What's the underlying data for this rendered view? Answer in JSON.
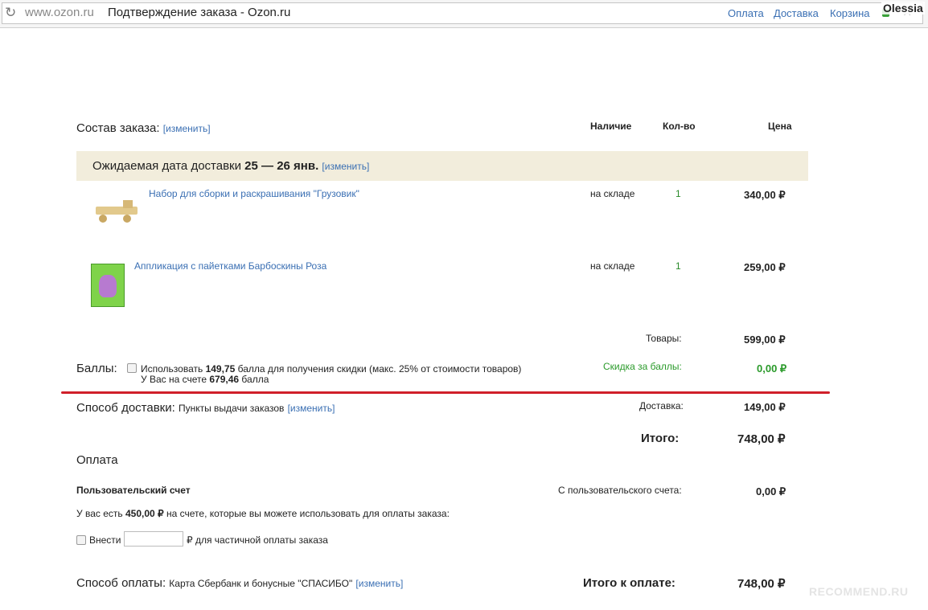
{
  "browser": {
    "url": "www.ozon.ru",
    "title": "Подтверждение заказа - Ozon.ru",
    "links": [
      "Оплата",
      "Доставка",
      "Корзина"
    ],
    "user": "Olessia"
  },
  "order": {
    "label": "Состав заказа:",
    "change": "[изменить]",
    "columns": {
      "availability": "Наличие",
      "qty": "Кол-во",
      "price": "Цена"
    },
    "delivery_date": {
      "prefix": "Ожидаемая дата доставки",
      "date": "25 — 26 янв.",
      "change": "[изменить]"
    },
    "items": [
      {
        "name": "Набор для сборки и раскрашивания \"Грузовик\"",
        "availability": "на складе",
        "qty": "1",
        "price": "340,00 ₽",
        "image_icon": "truck-toy-image"
      },
      {
        "name": "Аппликация с пайетками Барбоскины Роза",
        "availability": "на складе",
        "qty": "1",
        "price": "259,00 ₽",
        "image_icon": "craft-kit-image"
      }
    ],
    "goods_label": "Товары:",
    "goods_value": "599,00 ₽"
  },
  "points": {
    "label": "Баллы:",
    "use_text_pre": "Использовать",
    "use_amount": "149,75",
    "use_text_post": "балла для получения скидки (макс. 25% от стоимости товаров)",
    "balance_pre": "У Вас на счете",
    "balance_amount": "679,46",
    "balance_post": "балла",
    "discount_label": "Скидка за баллы:",
    "discount_value": "0,00 ₽"
  },
  "shipping": {
    "label": "Способ доставки:",
    "method": "Пункты выдачи заказов",
    "change": "[изменить]",
    "cost_label": "Доставка:",
    "cost_value": "149,00 ₽",
    "total_label": "Итого:",
    "total_value": "748,00 ₽"
  },
  "payment": {
    "label": "Оплата",
    "account_title": "Пользовательский счет",
    "account_charge_label": "С пользовательского счета:",
    "account_charge_value": "0,00 ₽",
    "balance_pre": "У вас есть",
    "balance_amount": "450,00 ₽",
    "balance_post": "на счете, которые вы можете использовать для оплаты заказа:",
    "deposit_label": "Внести",
    "deposit_suffix": "₽ для частичной оплаты заказа",
    "method_label": "Способ оплаты:",
    "method": "Карта Сбербанк и бонусные \"СПАСИБО\"",
    "change": "[изменить]",
    "due_label": "Итого к оплате:",
    "due_value": "748,00 ₽"
  },
  "watermark": "RECOMMEND.RU",
  "colors": {
    "link": "#3a6fb3",
    "band": "#f2eddc",
    "accent_red": "#d0202a",
    "green": "#2a9a2a"
  }
}
